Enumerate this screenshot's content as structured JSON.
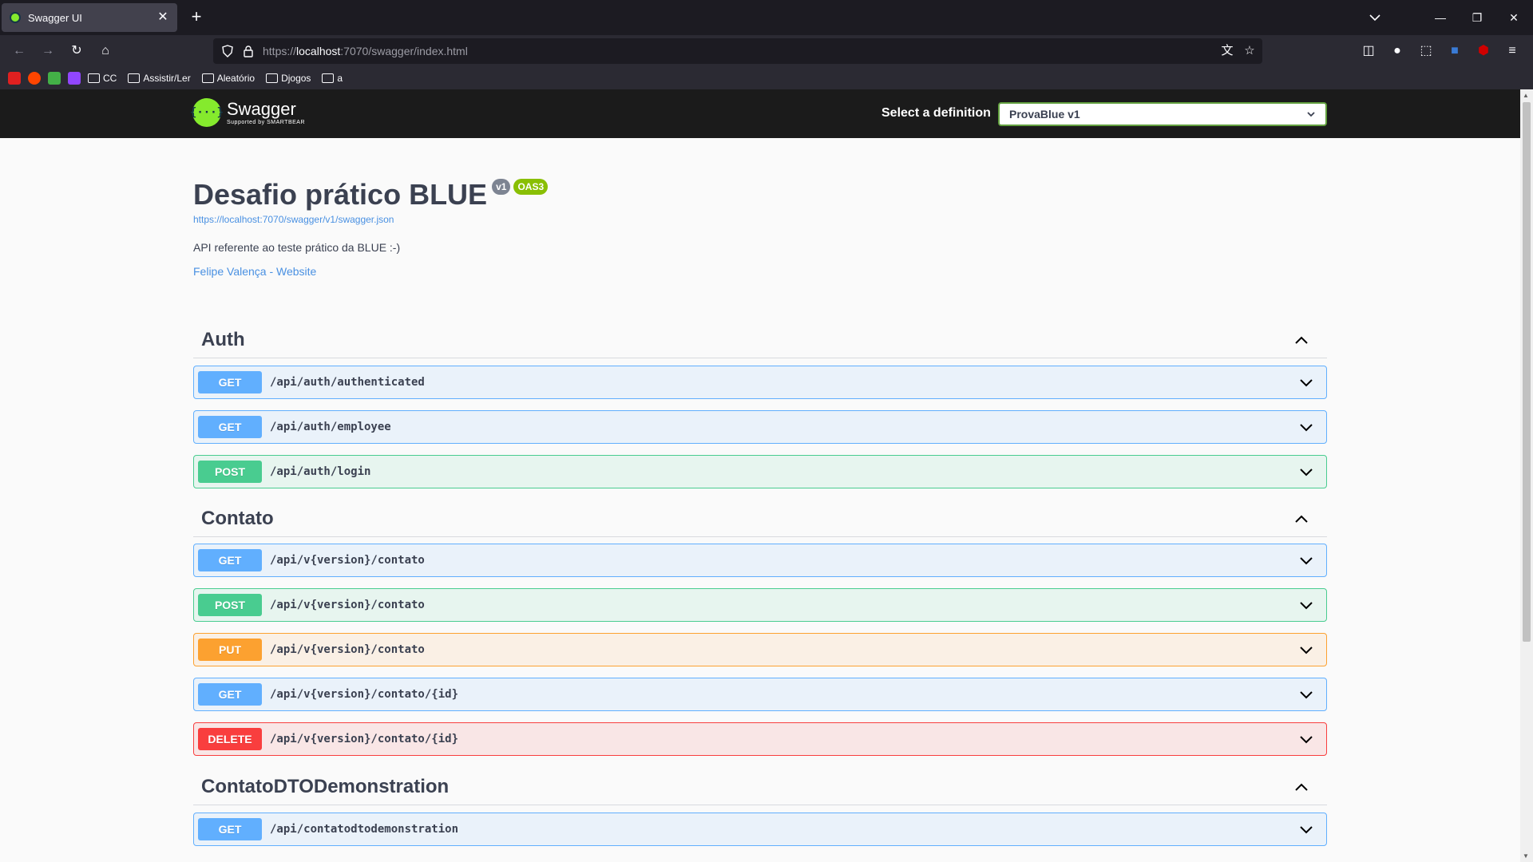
{
  "browser": {
    "tab_title": "Swagger UI",
    "tab_close": "✕",
    "new_tab": "+",
    "url_prefix": "https://",
    "url_host": "localhost",
    "url_rest": ":7070/swagger/index.html",
    "bookmarks": [
      {
        "label": "CC"
      },
      {
        "label": "Assistir/Ler"
      },
      {
        "label": "Aleatório"
      },
      {
        "label": "Djogos"
      },
      {
        "label": "a"
      }
    ],
    "bookmark_icon_colors": [
      "#e02020",
      "#ff4500",
      "#43b047",
      "#9146ff"
    ]
  },
  "swagger": {
    "logo_mark": "{···}",
    "logo_name": "Swagger",
    "logo_sub": "Supported by SMARTBEAR",
    "definition_label": "Select a definition",
    "definition_value": "ProvaBlue v1"
  },
  "info": {
    "title": "Desafio prático BLUE",
    "version_badge": "v1",
    "oas_badge": "OAS3",
    "spec_url": "https://localhost:7070/swagger/v1/swagger.json",
    "description": "API referente ao teste prático da BLUE :-)",
    "contact": "Felipe Valença - Website"
  },
  "sections": [
    {
      "name": "Auth",
      "operations": [
        {
          "method": "GET",
          "path": "/api/auth/authenticated"
        },
        {
          "method": "GET",
          "path": "/api/auth/employee"
        },
        {
          "method": "POST",
          "path": "/api/auth/login"
        }
      ]
    },
    {
      "name": "Contato",
      "operations": [
        {
          "method": "GET",
          "path": "/api/v{version}/contato"
        },
        {
          "method": "POST",
          "path": "/api/v{version}/contato"
        },
        {
          "method": "PUT",
          "path": "/api/v{version}/contato"
        },
        {
          "method": "GET",
          "path": "/api/v{version}/contato/{id}"
        },
        {
          "method": "DELETE",
          "path": "/api/v{version}/contato/{id}"
        }
      ]
    },
    {
      "name": "ContatoDTODemonstration",
      "operations": [
        {
          "method": "GET",
          "path": "/api/contatodtodemonstration"
        }
      ]
    }
  ],
  "colors": {
    "get": "#61affe",
    "post": "#49cc90",
    "put": "#fca130",
    "delete": "#f93e3e",
    "swagger_green": "#85ea2d",
    "link": "#4990e2"
  }
}
